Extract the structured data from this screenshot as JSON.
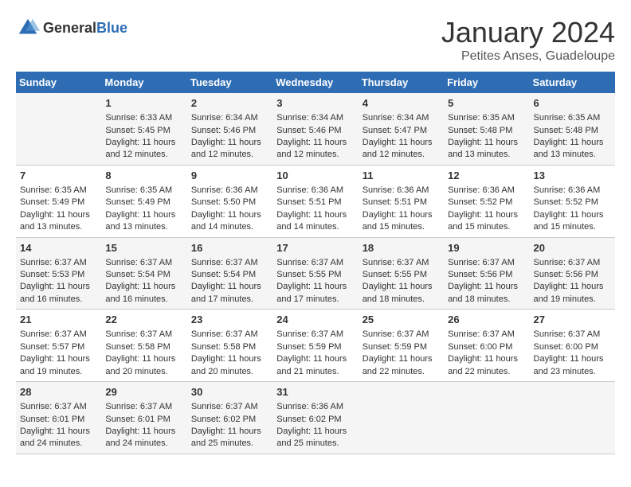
{
  "logo": {
    "general": "General",
    "blue": "Blue"
  },
  "title": "January 2024",
  "location": "Petites Anses, Guadeloupe",
  "days_header": [
    "Sunday",
    "Monday",
    "Tuesday",
    "Wednesday",
    "Thursday",
    "Friday",
    "Saturday"
  ],
  "weeks": [
    [
      {
        "day": "",
        "sunrise": "",
        "sunset": "",
        "daylight": ""
      },
      {
        "day": "1",
        "sunrise": "Sunrise: 6:33 AM",
        "sunset": "Sunset: 5:45 PM",
        "daylight": "Daylight: 11 hours and 12 minutes."
      },
      {
        "day": "2",
        "sunrise": "Sunrise: 6:34 AM",
        "sunset": "Sunset: 5:46 PM",
        "daylight": "Daylight: 11 hours and 12 minutes."
      },
      {
        "day": "3",
        "sunrise": "Sunrise: 6:34 AM",
        "sunset": "Sunset: 5:46 PM",
        "daylight": "Daylight: 11 hours and 12 minutes."
      },
      {
        "day": "4",
        "sunrise": "Sunrise: 6:34 AM",
        "sunset": "Sunset: 5:47 PM",
        "daylight": "Daylight: 11 hours and 12 minutes."
      },
      {
        "day": "5",
        "sunrise": "Sunrise: 6:35 AM",
        "sunset": "Sunset: 5:48 PM",
        "daylight": "Daylight: 11 hours and 13 minutes."
      },
      {
        "day": "6",
        "sunrise": "Sunrise: 6:35 AM",
        "sunset": "Sunset: 5:48 PM",
        "daylight": "Daylight: 11 hours and 13 minutes."
      }
    ],
    [
      {
        "day": "7",
        "sunrise": "Sunrise: 6:35 AM",
        "sunset": "Sunset: 5:49 PM",
        "daylight": "Daylight: 11 hours and 13 minutes."
      },
      {
        "day": "8",
        "sunrise": "Sunrise: 6:35 AM",
        "sunset": "Sunset: 5:49 PM",
        "daylight": "Daylight: 11 hours and 13 minutes."
      },
      {
        "day": "9",
        "sunrise": "Sunrise: 6:36 AM",
        "sunset": "Sunset: 5:50 PM",
        "daylight": "Daylight: 11 hours and 14 minutes."
      },
      {
        "day": "10",
        "sunrise": "Sunrise: 6:36 AM",
        "sunset": "Sunset: 5:51 PM",
        "daylight": "Daylight: 11 hours and 14 minutes."
      },
      {
        "day": "11",
        "sunrise": "Sunrise: 6:36 AM",
        "sunset": "Sunset: 5:51 PM",
        "daylight": "Daylight: 11 hours and 15 minutes."
      },
      {
        "day": "12",
        "sunrise": "Sunrise: 6:36 AM",
        "sunset": "Sunset: 5:52 PM",
        "daylight": "Daylight: 11 hours and 15 minutes."
      },
      {
        "day": "13",
        "sunrise": "Sunrise: 6:36 AM",
        "sunset": "Sunset: 5:52 PM",
        "daylight": "Daylight: 11 hours and 15 minutes."
      }
    ],
    [
      {
        "day": "14",
        "sunrise": "Sunrise: 6:37 AM",
        "sunset": "Sunset: 5:53 PM",
        "daylight": "Daylight: 11 hours and 16 minutes."
      },
      {
        "day": "15",
        "sunrise": "Sunrise: 6:37 AM",
        "sunset": "Sunset: 5:54 PM",
        "daylight": "Daylight: 11 hours and 16 minutes."
      },
      {
        "day": "16",
        "sunrise": "Sunrise: 6:37 AM",
        "sunset": "Sunset: 5:54 PM",
        "daylight": "Daylight: 11 hours and 17 minutes."
      },
      {
        "day": "17",
        "sunrise": "Sunrise: 6:37 AM",
        "sunset": "Sunset: 5:55 PM",
        "daylight": "Daylight: 11 hours and 17 minutes."
      },
      {
        "day": "18",
        "sunrise": "Sunrise: 6:37 AM",
        "sunset": "Sunset: 5:55 PM",
        "daylight": "Daylight: 11 hours and 18 minutes."
      },
      {
        "day": "19",
        "sunrise": "Sunrise: 6:37 AM",
        "sunset": "Sunset: 5:56 PM",
        "daylight": "Daylight: 11 hours and 18 minutes."
      },
      {
        "day": "20",
        "sunrise": "Sunrise: 6:37 AM",
        "sunset": "Sunset: 5:56 PM",
        "daylight": "Daylight: 11 hours and 19 minutes."
      }
    ],
    [
      {
        "day": "21",
        "sunrise": "Sunrise: 6:37 AM",
        "sunset": "Sunset: 5:57 PM",
        "daylight": "Daylight: 11 hours and 19 minutes."
      },
      {
        "day": "22",
        "sunrise": "Sunrise: 6:37 AM",
        "sunset": "Sunset: 5:58 PM",
        "daylight": "Daylight: 11 hours and 20 minutes."
      },
      {
        "day": "23",
        "sunrise": "Sunrise: 6:37 AM",
        "sunset": "Sunset: 5:58 PM",
        "daylight": "Daylight: 11 hours and 20 minutes."
      },
      {
        "day": "24",
        "sunrise": "Sunrise: 6:37 AM",
        "sunset": "Sunset: 5:59 PM",
        "daylight": "Daylight: 11 hours and 21 minutes."
      },
      {
        "day": "25",
        "sunrise": "Sunrise: 6:37 AM",
        "sunset": "Sunset: 5:59 PM",
        "daylight": "Daylight: 11 hours and 22 minutes."
      },
      {
        "day": "26",
        "sunrise": "Sunrise: 6:37 AM",
        "sunset": "Sunset: 6:00 PM",
        "daylight": "Daylight: 11 hours and 22 minutes."
      },
      {
        "day": "27",
        "sunrise": "Sunrise: 6:37 AM",
        "sunset": "Sunset: 6:00 PM",
        "daylight": "Daylight: 11 hours and 23 minutes."
      }
    ],
    [
      {
        "day": "28",
        "sunrise": "Sunrise: 6:37 AM",
        "sunset": "Sunset: 6:01 PM",
        "daylight": "Daylight: 11 hours and 24 minutes."
      },
      {
        "day": "29",
        "sunrise": "Sunrise: 6:37 AM",
        "sunset": "Sunset: 6:01 PM",
        "daylight": "Daylight: 11 hours and 24 minutes."
      },
      {
        "day": "30",
        "sunrise": "Sunrise: 6:37 AM",
        "sunset": "Sunset: 6:02 PM",
        "daylight": "Daylight: 11 hours and 25 minutes."
      },
      {
        "day": "31",
        "sunrise": "Sunrise: 6:36 AM",
        "sunset": "Sunset: 6:02 PM",
        "daylight": "Daylight: 11 hours and 25 minutes."
      },
      {
        "day": "",
        "sunrise": "",
        "sunset": "",
        "daylight": ""
      },
      {
        "day": "",
        "sunrise": "",
        "sunset": "",
        "daylight": ""
      },
      {
        "day": "",
        "sunrise": "",
        "sunset": "",
        "daylight": ""
      }
    ]
  ]
}
